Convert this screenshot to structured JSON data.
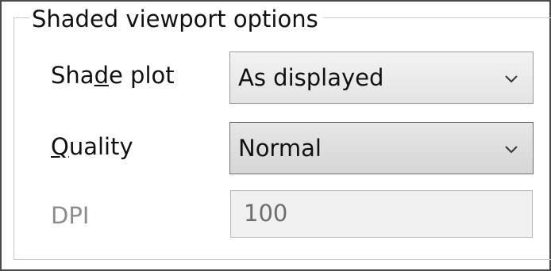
{
  "group": {
    "title": "Shaded viewport options"
  },
  "shade_plot": {
    "label": "Shade plot",
    "mnemonic": "d",
    "selected": "As displayed",
    "arrow_icon": "chevron-down-icon"
  },
  "quality": {
    "label": "Quality",
    "mnemonic": "Q",
    "selected": "Normal",
    "arrow_icon": "chevron-down-icon"
  },
  "dpi": {
    "label": "DPI",
    "value": "100",
    "enabled": false
  }
}
